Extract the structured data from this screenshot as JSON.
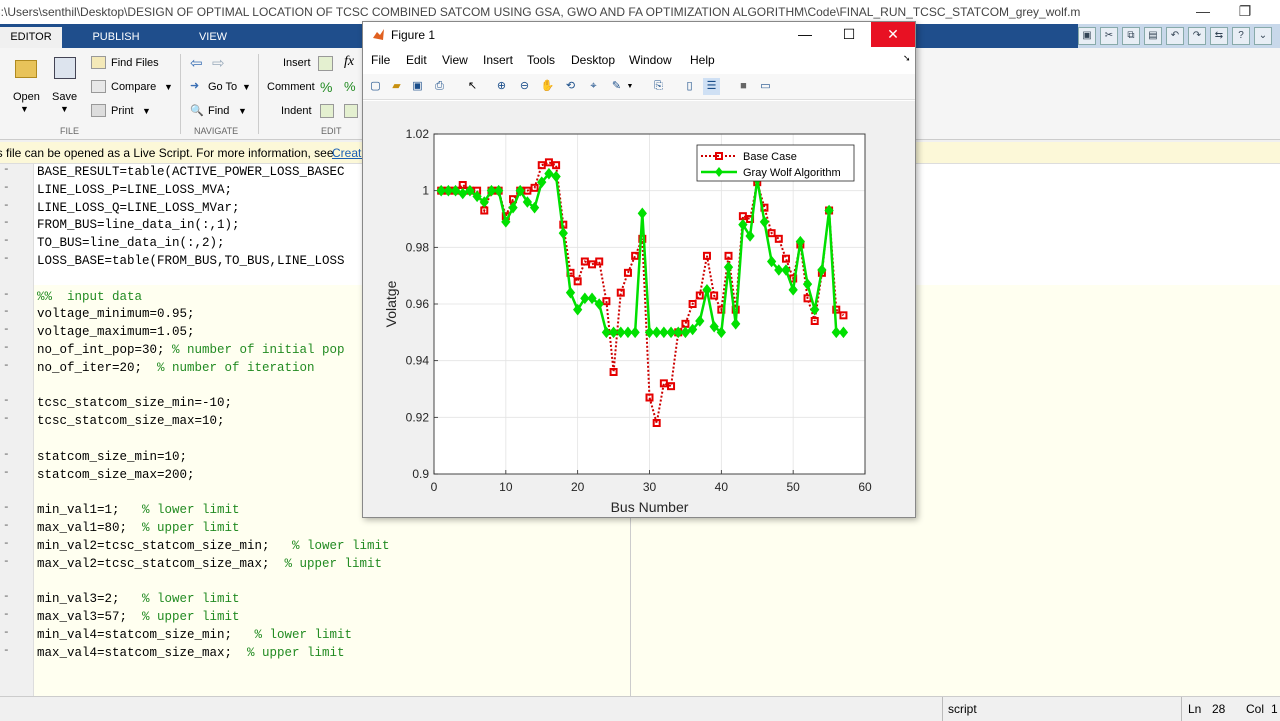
{
  "window": {
    "title": "C:\\Users\\senthil\\Desktop\\DESIGN OF OPTIMAL LOCATION OF TCSC COMBINED SATCOM USING GSA, GWO AND FA OPTIMIZATION ALGORITHM\\Code\\FINAL_RUN_TCSC_STATCOM_grey_wolf.m",
    "minimize": "—",
    "restore": "❐"
  },
  "ribbon": {
    "tabs": [
      "EDITOR",
      "PUBLISH",
      "VIEW"
    ],
    "file": {
      "open": "Open",
      "save": "Save",
      "find_files": "Find Files",
      "compare": "Compare",
      "print": "Print",
      "label": "FILE"
    },
    "navigate": {
      "go_to": "Go To",
      "find": "Find",
      "label": "NAVIGATE"
    },
    "edit": {
      "insert": "Insert",
      "comment": "Comment",
      "indent": "Indent",
      "fx": "fx",
      "label": "EDIT"
    }
  },
  "infobar": {
    "text": "This file can be opened as a Live Script. For more information, see ",
    "link": "Creati"
  },
  "code_lines": [
    "BASE_RESULT=table(ACTIVE_POWER_LOSS_BASEC",
    "LINE_LOSS_P=LINE_LOSS_MVA;",
    "LINE_LOSS_Q=LINE_LOSS_MVar;",
    "FROM_BUS=line_data_in(:,1);",
    "TO_BUS=line_data_in(:,2);",
    "LOSS_BASE=table(FROM_BUS,TO_BUS,LINE_LOSS",
    "",
    "%%  input data",
    "voltage_minimum=0.95;",
    "voltage_maximum=1.05;",
    "no_of_int_pop=30; % number of initial pop",
    "no_of_iter=20;  % number of iteration",
    "",
    "tcsc_statcom_size_min=-10;",
    "tcsc_statcom_size_max=10;",
    "",
    "statcom_size_min=10;",
    "statcom_size_max=200;",
    "",
    "min_val1=1;   % lower limit",
    "max_val1=80;  % upper limit",
    "min_val2=tcsc_statcom_size_min;   % lower limit",
    "max_val2=tcsc_statcom_size_max;  % upper limit",
    "",
    "min_val3=2;   % lower limit",
    "max_val3=57;  % upper limit",
    "min_val4=statcom_size_min;   % lower limit",
    "max_val4=statcom_size_max;  % upper limit"
  ],
  "status": {
    "mode": "script",
    "ln_label": "Ln",
    "ln": "28",
    "col_label": "Col",
    "col": "1"
  },
  "figure": {
    "title": "Figure 1",
    "close": "✕",
    "minimize": "—",
    "maximize": "☐",
    "menu": [
      "File",
      "Edit",
      "View",
      "Insert",
      "Tools",
      "Desktop",
      "Window",
      "Help"
    ]
  },
  "chart_data": {
    "type": "line",
    "xlabel": "Bus Number",
    "ylabel": "Volatge",
    "xlim": [
      0,
      60
    ],
    "ylim": [
      0.9,
      1.02
    ],
    "xticks": [
      "0",
      "10",
      "20",
      "30",
      "40",
      "50",
      "60"
    ],
    "yticks": [
      "0.9",
      "0.92",
      "0.94",
      "0.96",
      "0.98",
      "1",
      "1.02"
    ],
    "grid": true,
    "legend_position": "top-right",
    "x": [
      1,
      2,
      3,
      4,
      5,
      6,
      7,
      8,
      9,
      10,
      11,
      12,
      13,
      14,
      15,
      16,
      17,
      18,
      19,
      20,
      21,
      22,
      23,
      24,
      25,
      26,
      27,
      28,
      29,
      30,
      31,
      32,
      33,
      34,
      35,
      36,
      37,
      38,
      39,
      40,
      41,
      42,
      43,
      44,
      45,
      46,
      47,
      48,
      49,
      50,
      51,
      52,
      53,
      54,
      55,
      56,
      57
    ],
    "series": [
      {
        "name": "Base Case",
        "color": "#cc0000",
        "values": [
          1.0,
          1.0,
          1.0,
          1.002,
          1.0,
          1.0,
          0.993,
          1.0,
          1.0,
          0.991,
          0.997,
          1.0,
          1.0,
          1.001,
          1.009,
          1.01,
          1.009,
          0.988,
          0.971,
          0.968,
          0.975,
          0.974,
          0.975,
          0.961,
          0.936,
          0.964,
          0.971,
          0.977,
          0.983,
          0.927,
          0.918,
          0.932,
          0.931,
          0.95,
          0.953,
          0.96,
          0.963,
          0.977,
          0.963,
          0.958,
          0.977,
          0.958,
          0.991,
          0.99,
          1.003,
          0.994,
          0.985,
          0.983,
          0.976,
          0.969,
          0.981,
          0.962,
          0.954,
          0.971,
          0.993,
          0.958,
          0.956
        ]
      },
      {
        "name": "Gray Wolf Algorithm",
        "color": "#00e000",
        "values": [
          1.0,
          1.0,
          1.0,
          0.999,
          1.0,
          0.998,
          0.996,
          1.0,
          1.0,
          0.989,
          0.994,
          1.0,
          0.996,
          0.994,
          1.003,
          1.006,
          1.005,
          0.985,
          0.964,
          0.958,
          0.962,
          0.962,
          0.96,
          0.95,
          0.95,
          0.95,
          0.95,
          0.95,
          0.992,
          0.95,
          0.95,
          0.95,
          0.95,
          0.95,
          0.95,
          0.951,
          0.954,
          0.965,
          0.952,
          0.95,
          0.973,
          0.953,
          0.988,
          0.984,
          1.004,
          0.989,
          0.975,
          0.972,
          0.972,
          0.965,
          0.982,
          0.967,
          0.958,
          0.972,
          0.993,
          0.95,
          0.95
        ]
      }
    ]
  }
}
